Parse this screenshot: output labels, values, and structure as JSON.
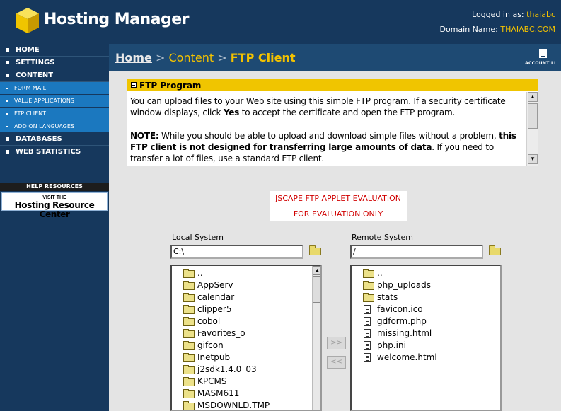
{
  "header": {
    "title": "Hosting Manager",
    "logged_in_label": "Logged in as:",
    "logged_in_user": "thaiabc",
    "domain_label": "Domain Name:",
    "domain_value": "THAIABC.COM"
  },
  "sidebar": {
    "items": [
      {
        "label": "HOME"
      },
      {
        "label": "SETTINGS"
      },
      {
        "label": "CONTENT"
      },
      {
        "label": "FORM MAIL"
      },
      {
        "label": "VALUE APPLICATIONS"
      },
      {
        "label": "FTP CLIENT"
      },
      {
        "label": "ADD ON LANGUAGES"
      },
      {
        "label": "DATABASES"
      },
      {
        "label": "WEB STATISTICS"
      }
    ],
    "help": {
      "title": "HELP RESOURCES",
      "banner_top": "VISIT THE",
      "banner_bottom": "Hosting Resource Center"
    }
  },
  "breadcrumb": {
    "home": "Home",
    "sep": ">",
    "content": "Content",
    "current": "FTP Client"
  },
  "account": {
    "label": "ACCOUNT LI"
  },
  "panel": {
    "title": "FTP Program",
    "p1_a": "You can upload files to your Web site using this simple FTP program. If a security certificate window displays, click ",
    "p1_yes": "Yes",
    "p1_b": " to accept the certificate and open the FTP program.",
    "note_label": "NOTE:",
    "note_a": " While you should be able to upload and download simple files without a problem, ",
    "note_bold": "this FTP client is not designed for transferring large amounts of data",
    "note_b": ". If you need to transfer a lot of files, use a standard FTP client."
  },
  "evaluation": {
    "line1": "JSCAPE FTP APPLET EVALUATION",
    "line2": "FOR EVALUATION ONLY"
  },
  "local": {
    "label": "Local System",
    "path": "C:\\",
    "items": [
      {
        "name": "..",
        "type": "folder"
      },
      {
        "name": "AppServ",
        "type": "folder"
      },
      {
        "name": "calendar",
        "type": "folder"
      },
      {
        "name": "clipper5",
        "type": "folder"
      },
      {
        "name": "cobol",
        "type": "folder"
      },
      {
        "name": "Favorites_o",
        "type": "folder"
      },
      {
        "name": "gifcon",
        "type": "folder"
      },
      {
        "name": "Inetpub",
        "type": "folder"
      },
      {
        "name": "j2sdk1.4.0_03",
        "type": "folder"
      },
      {
        "name": "KPCMS",
        "type": "folder"
      },
      {
        "name": "MASM611",
        "type": "folder"
      },
      {
        "name": "MSDOWNLD.TMP",
        "type": "folder"
      }
    ]
  },
  "remote": {
    "label": "Remote System",
    "path": "/",
    "items": [
      {
        "name": "..",
        "type": "folder"
      },
      {
        "name": "php_uploads",
        "type": "folder"
      },
      {
        "name": "stats",
        "type": "folder"
      },
      {
        "name": "favicon.ico",
        "type": "file"
      },
      {
        "name": "gdform.php",
        "type": "file"
      },
      {
        "name": "missing.html",
        "type": "file"
      },
      {
        "name": "php.ini",
        "type": "file"
      },
      {
        "name": "welcome.html",
        "type": "file"
      }
    ]
  },
  "transfer": {
    "upload": ">>",
    "download": "<<"
  },
  "colors": {
    "nav_bg": "#16385d",
    "accent": "#f3c200",
    "sub_nav": "#1b78bf",
    "warning": "#d00000"
  }
}
